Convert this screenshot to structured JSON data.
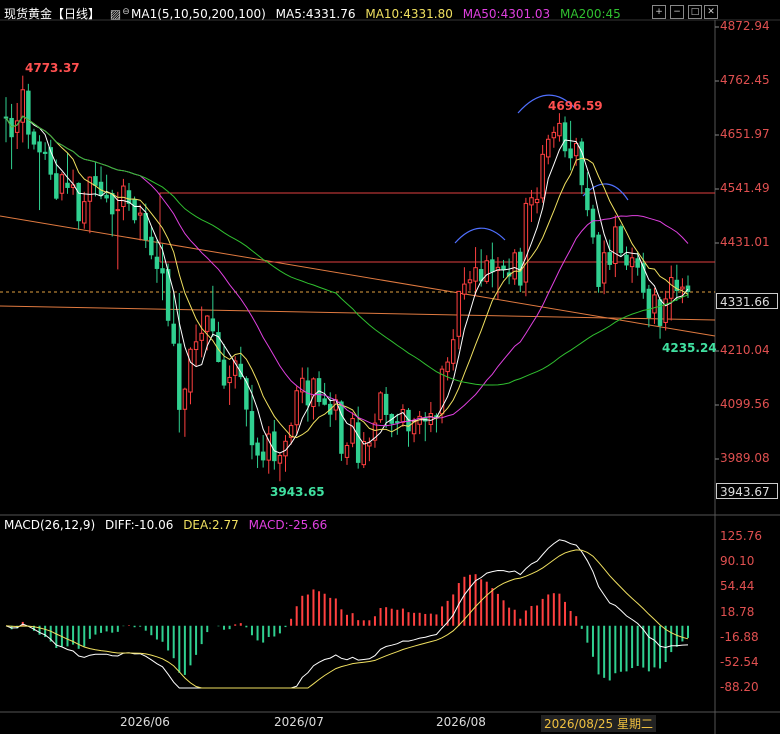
{
  "header": {
    "title": "现货黄金【日线】",
    "indicator": "MA1(5,10,50,200,100)",
    "ma5": "MA5:4331.76",
    "ma10": "MA10:4331.80",
    "ma50": "MA50:4301.03",
    "ma200": "MA200:45",
    "colors": {
      "ma5": "#ffffff",
      "ma10": "#f0e060",
      "ma50": "#e040e0",
      "ma200": "#30c030"
    }
  },
  "macd_header": {
    "label": "MACD(26,12,9)",
    "diff": "DIFF:-10.06",
    "dea": "DEA:2.77",
    "macd": "MACD:-25.66"
  },
  "price_axis": [
    "4872.94",
    "4762.45",
    "4651.97",
    "4541.49",
    "4431.01",
    "4210.04",
    "4099.56",
    "3989.08"
  ],
  "current_price": "4331.66",
  "low_box": "3943.67",
  "macd_axis": [
    "125.76",
    "90.10",
    "54.44",
    "18.78",
    "-16.88",
    "-52.54",
    "-88.20"
  ],
  "x_labels": [
    "2026/06",
    "2026/07",
    "2026/08"
  ],
  "cursor_date": "2026/08/25 星期二",
  "annotations": {
    "high_left": "4773.37",
    "high_mid": "4696.59",
    "low_left": "3943.65",
    "low_right": "4235.24"
  },
  "chart_data": {
    "type": "candlestick",
    "title": "现货黄金【日线】",
    "y_range": [
      3943.67,
      4872.94
    ],
    "ohlc": [
      [
        4688.67,
        4729.53,
        4637.25,
        4687.6
      ],
      [
        4685.78,
        4715.55,
        4581.96,
        4648.51
      ],
      [
        4657.34,
        4717.52,
        4623.33,
        4680.89
      ],
      [
        4678.04,
        4773.37,
        4636.78,
        4744.54
      ],
      [
        4741.68,
        4756.64,
        4623.78,
        4653.84
      ],
      [
        4658.07,
        4664.71,
        4622.29,
        4633.45
      ],
      [
        4637.74,
        4651.54,
        4498.41,
        4617.45
      ],
      [
        4616.6,
        4637.14,
        4600.97,
        4614.22
      ],
      [
        4626.16,
        4642.14,
        4560.13,
        4571.9
      ],
      [
        4572.75,
        4601.87,
        4519.08,
        4522.75
      ],
      [
        4532.79,
        4575.88,
        4518.09,
        4570.77
      ],
      [
        4553.28,
        4614.98,
        4531.63,
        4544.67
      ],
      [
        4544.65,
        4581.16,
        4529.59,
        4549.89
      ],
      [
        4552.91,
        4555.05,
        4458.35,
        4476.61
      ],
      [
        4471.88,
        4535.78,
        4460.15,
        4515.63
      ],
      [
        4516.4,
        4567.61,
        4451.03,
        4565.74
      ],
      [
        4566.85,
        4597.77,
        4526.38,
        4549.08
      ],
      [
        4555.25,
        4587.7,
        4520.6,
        4528.01
      ],
      [
        4528.64,
        4570.73,
        4514.07,
        4523.26
      ],
      [
        4532.3,
        4539.81,
        4444.28,
        4490.67
      ],
      [
        4498.26,
        4535.66,
        4377.01,
        4499.33
      ],
      [
        4505.66,
        4562.19,
        4477.5,
        4547.52
      ],
      [
        4537.9,
        4553.76,
        4496.8,
        4512.3
      ],
      [
        4519.24,
        4526.1,
        4471.12,
        4478.66
      ],
      [
        4488.17,
        4509.62,
        4436.16,
        4492.1
      ],
      [
        4491.3,
        4511.65,
        4420.76,
        4438.06
      ],
      [
        4442.75,
        4463.46,
        4397.67,
        4406.89
      ],
      [
        4401.9,
        4436.96,
        4349.51,
        4378.96
      ],
      [
        4378.43,
        4428.75,
        4313.87,
        4369.78
      ],
      [
        4376.69,
        4388.87,
        4260.45,
        4272.87
      ],
      [
        4264.92,
        4329.79,
        4219.93,
        4225.93
      ],
      [
        4224.4,
        4328.59,
        4043.39,
        4090.62
      ],
      [
        4090.84,
        4134.96,
        4034.47,
        4132.01
      ],
      [
        4126.15,
        4217.63,
        4101.05,
        4213.6
      ],
      [
        4213.07,
        4264.22,
        4178.65,
        4228.87
      ],
      [
        4231.84,
        4301.12,
        4197.07,
        4246.22
      ],
      [
        4250.21,
        4283.39,
        4211.4,
        4281.59
      ],
      [
        4275.65,
        4343.42,
        4239.14,
        4251.28
      ],
      [
        4247.66,
        4269.82,
        4186.61,
        4188.56
      ],
      [
        4191.32,
        4224.36,
        4132.75,
        4140.42
      ],
      [
        4145.45,
        4180.36,
        4099.67,
        4155.89
      ],
      [
        4160.2,
        4199.37,
        4133.2,
        4189.68
      ],
      [
        4182.85,
        4218.76,
        4152.06,
        4157.7
      ],
      [
        4153.46,
        4158.44,
        4055.73,
        4091.21
      ],
      [
        4086.14,
        4140.71,
        3988.4,
        4018.39
      ],
      [
        4021.65,
        4032.89,
        3970.73,
        3997.14
      ],
      [
        4003.22,
        4038.05,
        3971.58,
        3987.25
      ],
      [
        3986.78,
        4056.21,
        3959.03,
        4040.26
      ],
      [
        4044.39,
        4068.99,
        3967.34,
        3985.73
      ],
      [
        3980.57,
        4001.66,
        3943.65,
        3996.13
      ],
      [
        3995.53,
        4038.03,
        3962.97,
        4025.33
      ],
      [
        4033.43,
        4063.86,
        4018.47,
        4057.48
      ],
      [
        4059.14,
        4137.75,
        4038.52,
        4128.7
      ],
      [
        4126.36,
        4176.32,
        4103.28,
        4154.22
      ],
      [
        4148.75,
        4176.47,
        4065.61,
        4099.85
      ],
      [
        4096.41,
        4156.1,
        4069.93,
        4152.94
      ],
      [
        4153.55,
        4168.49,
        4096.73,
        4106.67
      ],
      [
        4112.02,
        4144.71,
        4098.65,
        4101.17
      ],
      [
        4100.75,
        4125.54,
        4054.76,
        4080.85
      ],
      [
        4089.17,
        4121.53,
        4068.47,
        4109.99
      ],
      [
        4105.71,
        4109.15,
        3985.21,
        4000.77
      ],
      [
        3992.36,
        4022.98,
        3977.02,
        4016.68
      ],
      [
        4021.46,
        4084.72,
        4013.22,
        4071.82
      ],
      [
        4063.08,
        4096.37,
        3969.38,
        3982.17
      ],
      [
        3977.52,
        4044.18,
        3970.63,
        4024.88
      ],
      [
        4015.74,
        4033.02,
        3984.6,
        4022.04
      ],
      [
        4027.6,
        4082.08,
        4012.08,
        4062.59
      ],
      [
        4069.53,
        4127.66,
        4063.2,
        4124.27
      ],
      [
        4121.26,
        4136.34,
        4052.66,
        4080.19
      ],
      [
        4080.07,
        4082.59,
        4033.75,
        4062.17
      ],
      [
        4065.49,
        4081.46,
        4038.67,
        4064.56
      ],
      [
        4064.15,
        4101.07,
        4054.68,
        4090.39
      ],
      [
        4088.58,
        4093.37,
        4014.11,
        4046.77
      ],
      [
        4040.76,
        4073.27,
        4023.41,
        4068.04
      ],
      [
        4060.13,
        4087.33,
        4039.98,
        4076.25
      ],
      [
        4072.69,
        4085.01,
        4025.5,
        4066.91
      ],
      [
        4059.78,
        4105.76,
        4044.04,
        4082.12
      ],
      [
        4077.44,
        4082.55,
        4043.33,
        4074.61
      ],
      [
        4081.58,
        4180.11,
        4062.09,
        4172.94
      ],
      [
        4167.87,
        4197.43,
        4149.8,
        4187.36
      ],
      [
        4184.87,
        4254.7,
        4170.18,
        4233.13
      ],
      [
        4240.1,
        4330.98,
        4213.5,
        4332.02
      ],
      [
        4326.28,
        4381.47,
        4315.23,
        4346.91
      ],
      [
        4349.7,
        4373.69,
        4333.5,
        4355.67
      ],
      [
        4352.98,
        4422.64,
        4322.93,
        4380.48
      ],
      [
        4376.7,
        4418.23,
        4341.8,
        4353.42
      ],
      [
        4352.46,
        4405.98,
        4347.72,
        4394.64
      ],
      [
        4396.53,
        4431.88,
        4340.3,
        4372.33
      ],
      [
        4374.72,
        4402.22,
        4316.69,
        4381.18
      ],
      [
        4383.81,
        4396.36,
        4359.4,
        4376.82
      ],
      [
        4369.77,
        4399.33,
        4346.66,
        4363.5
      ],
      [
        4357.52,
        4418.36,
        4345.38,
        4410.87
      ],
      [
        4412.09,
        4421.21,
        4330.74,
        4344.9
      ],
      [
        4351.12,
        4523.41,
        4322.08,
        4511.96
      ],
      [
        4508.96,
        4539.52,
        4474.02,
        4523.57
      ],
      [
        4513.73,
        4544.86,
        4491.6,
        4520.22
      ],
      [
        4523.25,
        4631.51,
        4513.34,
        4612.4
      ],
      [
        4607.1,
        4652.39,
        4591.99,
        4643.22
      ],
      [
        4646.35,
        4669.33,
        4625.9,
        4657.23
      ],
      [
        4650.38,
        4696.59,
        4638.47,
        4675.65
      ],
      [
        4676.76,
        4689.91,
        4606.34,
        4619.81
      ],
      [
        4623.36,
        4680.88,
        4579.65,
        4605.35
      ],
      [
        4609.56,
        4646.14,
        4589.07,
        4634.63
      ],
      [
        4637.57,
        4645.41,
        4531.42,
        4550.33
      ],
      [
        4542.41,
        4575.77,
        4485.73,
        4499.23
      ],
      [
        4500.19,
        4509.16,
        4429.28,
        4443.46
      ],
      [
        4447.07,
        4453.48,
        4329.37,
        4342.09
      ],
      [
        4349.09,
        4436.22,
        4326.34,
        4411.06
      ],
      [
        4411.33,
        4437.9,
        4375.75,
        4387.18
      ],
      [
        4389.08,
        4487.85,
        4361.32,
        4463.94
      ],
      [
        4464.4,
        4468.83,
        4402.28,
        4411.43
      ],
      [
        4406.04,
        4423.84,
        4375.8,
        4386.07
      ],
      [
        4382.72,
        4421.65,
        4349.48,
        4400.72
      ],
      [
        4398.75,
        4414.1,
        4364.17,
        4381.49
      ],
      [
        4388.76,
        4411.06,
        4316.83,
        4330.28
      ],
      [
        4336.36,
        4345.25,
        4258.6,
        4278.57
      ],
      [
        4287.87,
        4339.05,
        4265.44,
        4324.78
      ],
      [
        4314.88,
        4320.82,
        4235.24,
        4262.31
      ],
      [
        4268.41,
        4333.31,
        4251.93,
        4316.57
      ],
      [
        4317.98,
        4384.88,
        4272.41,
        4360.34
      ],
      [
        4354.75,
        4386.61,
        4312.28,
        4333.8
      ],
      [
        4337.04,
        4358.87,
        4307.94,
        4340.77
      ],
      [
        4342.94,
        4364.6,
        4318.47,
        4331.66
      ]
    ],
    "ma5_last": 4331.76,
    "ma10_last": 4331.8,
    "ma50_last": 4301.03,
    "macd": {
      "diff_last": -10.06,
      "dea_last": 2.77,
      "hist_last": -25.66,
      "y_range": [
        -88.2,
        125.76
      ]
    }
  }
}
